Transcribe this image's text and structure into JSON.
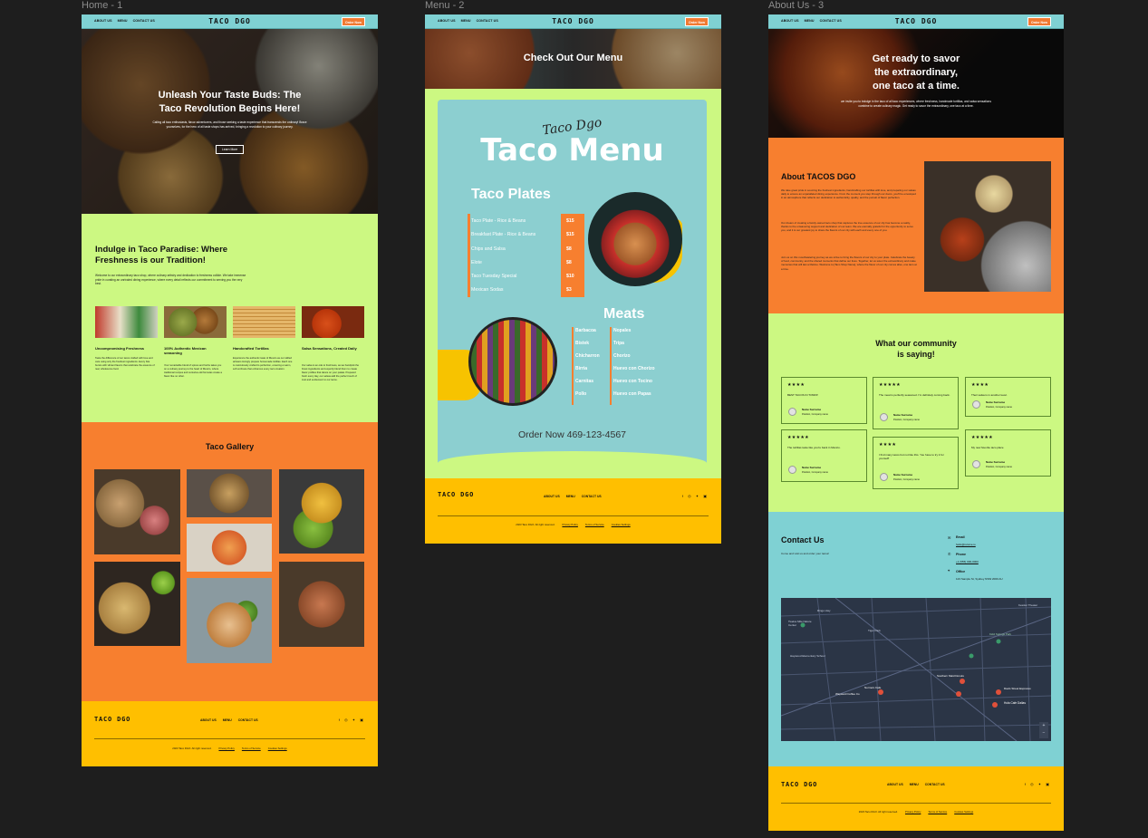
{
  "frames": {
    "home": "Home - 1",
    "menu": "Menu - 2",
    "about": "About Us - 3"
  },
  "nav": {
    "about": "ABOUT US",
    "menu": "MENU",
    "contact": "CONTACT US",
    "logo": "TACO DGO",
    "order": "Order Now"
  },
  "home": {
    "hero_title_1": "Unleash Your Taste Buds: The",
    "hero_title_2": "Taco Revolution Begins Here!",
    "hero_text": "Calling all taco enthusiasts, flavor adventurers, and those seeking a taste experience that transcends the ordinary! Brace yourselves, for the hero of all taste shops has arrived, bringing a revolution to your culinary journey.",
    "hero_button": "Learn More",
    "intro_title_1": "Indulge in Taco Paradise: Where",
    "intro_title_2": "Freshness is our Tradition!",
    "intro_text": "Welcome to our extraordinary taco shop, where culinary artistry and dedication to freshness collide. We take immense pride in curating an unrivaled dining experience, where every detail reflects our commitment to serving you the very best.",
    "features": [
      {
        "title": "Uncompromising Freshness",
        "text": "Taste the difference of our tacos crafted with love and care using only the freshest ingredients. Every bite bursts with vibrant flavors that celebrate the essence of real, wholesome food."
      },
      {
        "title": "100% Authentic Mexican seasoning",
        "text": "Your remarkable blend of spices and herbs takes you on a culinary journey to the heart of Mexico, where traditional recipes and centuries-old formulas create a flavor like no other."
      },
      {
        "title": "Handcrafted Tortillas",
        "text": "Experience the authentic taste of Mexico as our skilled artisans lovingly prepare homemade tortillas. Each one is meticulously crafted to perfection, ensuring a warm, soft embrace that enhances every taco creation."
      },
      {
        "title": "Salsa Sensations, Created Daily",
        "text": "Our salsa is an ode to freshness, as we handpick the finest ingredients and expertly blend them to create flavor profiles that dance on your palate. Prepared fresh every day, our salsas add the perfect touch of zest and excitement to our tacos."
      }
    ],
    "gallery_title": "Taco Gallery"
  },
  "menu": {
    "hero_title": "Check Out Our Menu",
    "script": "Taco Dgo",
    "title": "Taco Menu",
    "plates_title": "Taco Plates",
    "plates": [
      {
        "name": "Taco Plate - Rice & Beans",
        "price": "$15"
      },
      {
        "name": "Breakfast Plate - Rice & Beans",
        "price": "$15"
      },
      {
        "name": "Chips and Salsa",
        "price": "$8"
      },
      {
        "name": "Elote",
        "price": "$8"
      },
      {
        "name": "Taco Tuesday Special",
        "price": "$10"
      },
      {
        "name": "Mexican Sodas",
        "price": "$3"
      }
    ],
    "meats_title": "Meats",
    "meats_left": [
      "Barbacoa",
      "Bistek",
      "Chicharron",
      "Birria",
      "Carnitas",
      "Pollo"
    ],
    "meats_right": [
      "Nopales",
      "Tripa",
      "Chorizo",
      "Huevo con Chorizo",
      "Huevo con Tocino",
      "Huevo con Papas"
    ],
    "order": "Order Now 469-123-4567"
  },
  "about": {
    "hero_1": "Get ready to savor",
    "hero_2": "the extraordinary,",
    "hero_3": "one taco at a time.",
    "hero_text": "we invite you to indulge in the taco of all taco experiences, where freshness, handmade tortillas, and salsa sensations combine to create culinary magic. Get ready to savor the extraordinary, one taco at a time.",
    "about_title": "About TACOS DGO",
    "about_p1": "We take great pride in sourcing the freshest ingredients, handcrafting our tortillas with love, and preparing our salsas daily to ensure an unparalleled dining experience. From the moment you step through our doors, you'll be enveloped in an atmosphere that reflects our dedication to authenticity, quality, and the pursuit of flavor perfection.",
    "about_p2": "Our dream of creating a family-owned taco shop that captures the true essence of our city has become a reality, thanks to the unwavering support and dedication of our team. We are eternally grateful for the opportunity to serve you, and it is our greatest joy to share the flavors of our city with each and every one of you.",
    "about_p3": "Join us on this mouthwatering journey as we strive to bring the flavors of our city to your plate. Celebrate the beauty of food, community, and the shared moments that define our lives. Together, let us savor the extraordinary and make memories that will last a lifetime. Welcome to [Taco Shop Name], where the flavor of our city comes alive, one taco at a time.",
    "community_1": "What our community",
    "community_2": "is saying!",
    "reviews": [
      {
        "stars": "★★★★",
        "text": "BEST TACOS IN TOWN!!",
        "name": "Name Surname",
        "pos": "Position, Company name"
      },
      {
        "stars": "★★★★★",
        "text": "The meat is perfectly seasoned. I'm definitely coming back.",
        "name": "Name Surname",
        "pos": "Position, Company name"
      },
      {
        "stars": "★★★★",
        "text": "Their salsa is in another level.",
        "name": "Name Surname",
        "pos": "Position, Company name"
      },
      {
        "stars": "★★★★★",
        "text": "The tortillas taste like you're back in Mexico.",
        "name": "Name Surname",
        "pos": "Position, Company name"
      },
      {
        "stars": "★★★★",
        "text": "I find many tacos but not like this. You have to try it for yourself!",
        "name": "Name Surname",
        "pos": "Position, Company name"
      },
      {
        "stars": "★★★★★",
        "text": "My new favorite taco place",
        "name": "Name Surname",
        "pos": "Position, Company name"
      }
    ],
    "contact_title": "Contact Us",
    "contact_text": "Come and visit us and order your tacos!",
    "email_label": "Email",
    "email": "hello@relume.io",
    "phone_label": "Phone",
    "phone": "+1 (555) 000-0000",
    "office_label": "Office",
    "office": "123 Sample St, Sydney NSW 2000 AU",
    "map_labels": [
      "Ringo Hwy",
      "Twelve Mile Nature Center",
      "Tiger Park",
      "Haywood Elementary School",
      "Southern Maid Donuts",
      "Norma's Cafe",
      "Wayward Coffee Co",
      "Hola Cafe Dallas",
      "Davis Street Espresso",
      "Kidd Springs Park",
      "Kessler Theater"
    ]
  },
  "footer": {
    "logo": "TACO DGO",
    "about": "ABOUT US",
    "menu": "MENU",
    "contact": "CONTACT US",
    "social": "f ◎ ✦ ▣",
    "copyright": "2023 Taco DGO. All right reserved.",
    "privacy": "Privacy Policy",
    "terms": "Terms of Service",
    "cookies": "Cookies Settings"
  }
}
